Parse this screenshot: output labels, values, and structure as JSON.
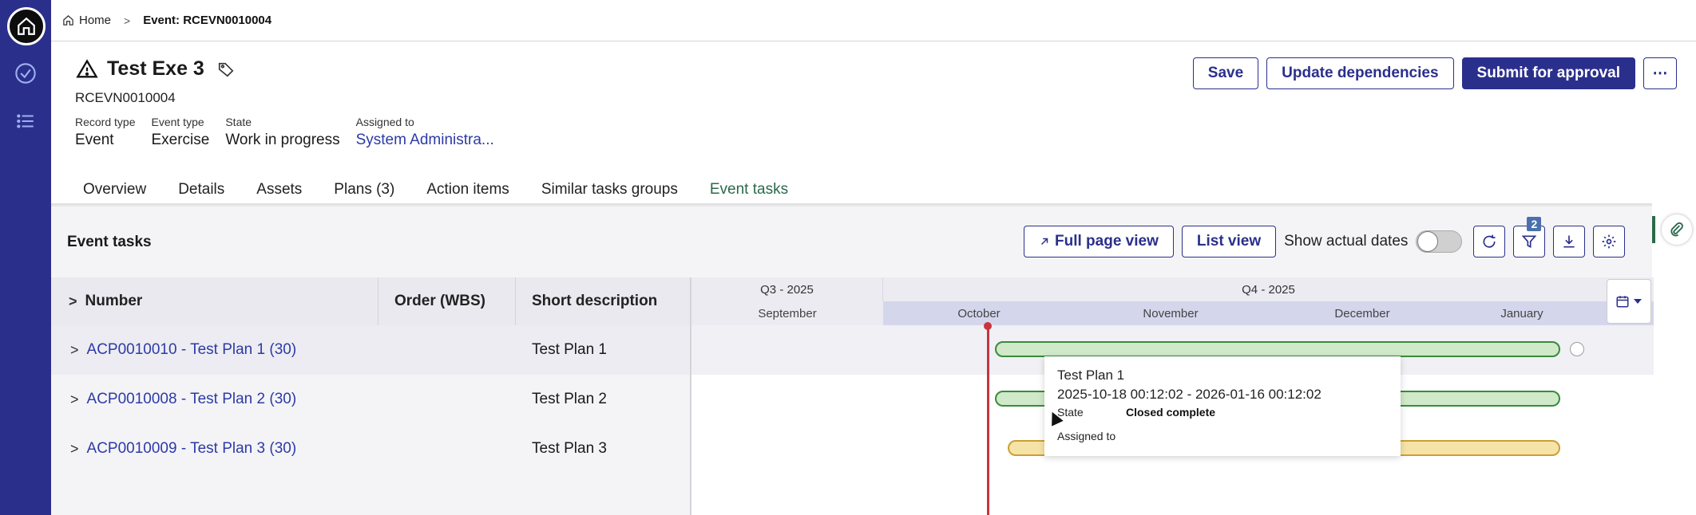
{
  "breadcrumb": {
    "home": "Home",
    "current": "Event: RCEVN0010004"
  },
  "record": {
    "title": "Test Exe 3",
    "number": "RCEVN0010004",
    "fields": [
      {
        "label": "Record type",
        "value": "Event"
      },
      {
        "label": "Event type",
        "value": "Exercise"
      },
      {
        "label": "State",
        "value": "Work in progress"
      },
      {
        "label": "Assigned to",
        "value": "System Administra..."
      }
    ]
  },
  "actions": {
    "save": "Save",
    "update": "Update dependencies",
    "submit": "Submit for approval",
    "more": "⋯"
  },
  "tabs": [
    "Overview",
    "Details",
    "Assets",
    "Plans (3)",
    "Action items",
    "Similar tasks groups",
    "Event tasks"
  ],
  "panel": {
    "title": "Event tasks",
    "full_page": "Full page view",
    "list_view": "List view",
    "show_actual": "Show actual dates",
    "filter_count": "2"
  },
  "table": {
    "columns": [
      "Number",
      "Order (WBS)",
      "Short description"
    ],
    "rows": [
      {
        "number": "ACP0010010 - Test Plan 1 (30)",
        "wbs": "",
        "desc": "Test Plan 1"
      },
      {
        "number": "ACP0010008 - Test Plan 2 (30)",
        "wbs": "",
        "desc": "Test Plan 2"
      },
      {
        "number": "ACP0010009 - Test Plan 3 (30)",
        "wbs": "",
        "desc": "Test Plan 3"
      }
    ]
  },
  "gantt": {
    "quarters": [
      "Q3 - 2025",
      "Q4 - 2025"
    ],
    "months": [
      "September",
      "October",
      "November",
      "December",
      "January"
    ]
  },
  "tooltip": {
    "title": "Test Plan 1",
    "dates": "2025-10-18 00:12:02 - 2026-01-16 00:12:02",
    "state_label": "State",
    "state_value": "Closed complete",
    "assigned_label": "Assigned to"
  }
}
